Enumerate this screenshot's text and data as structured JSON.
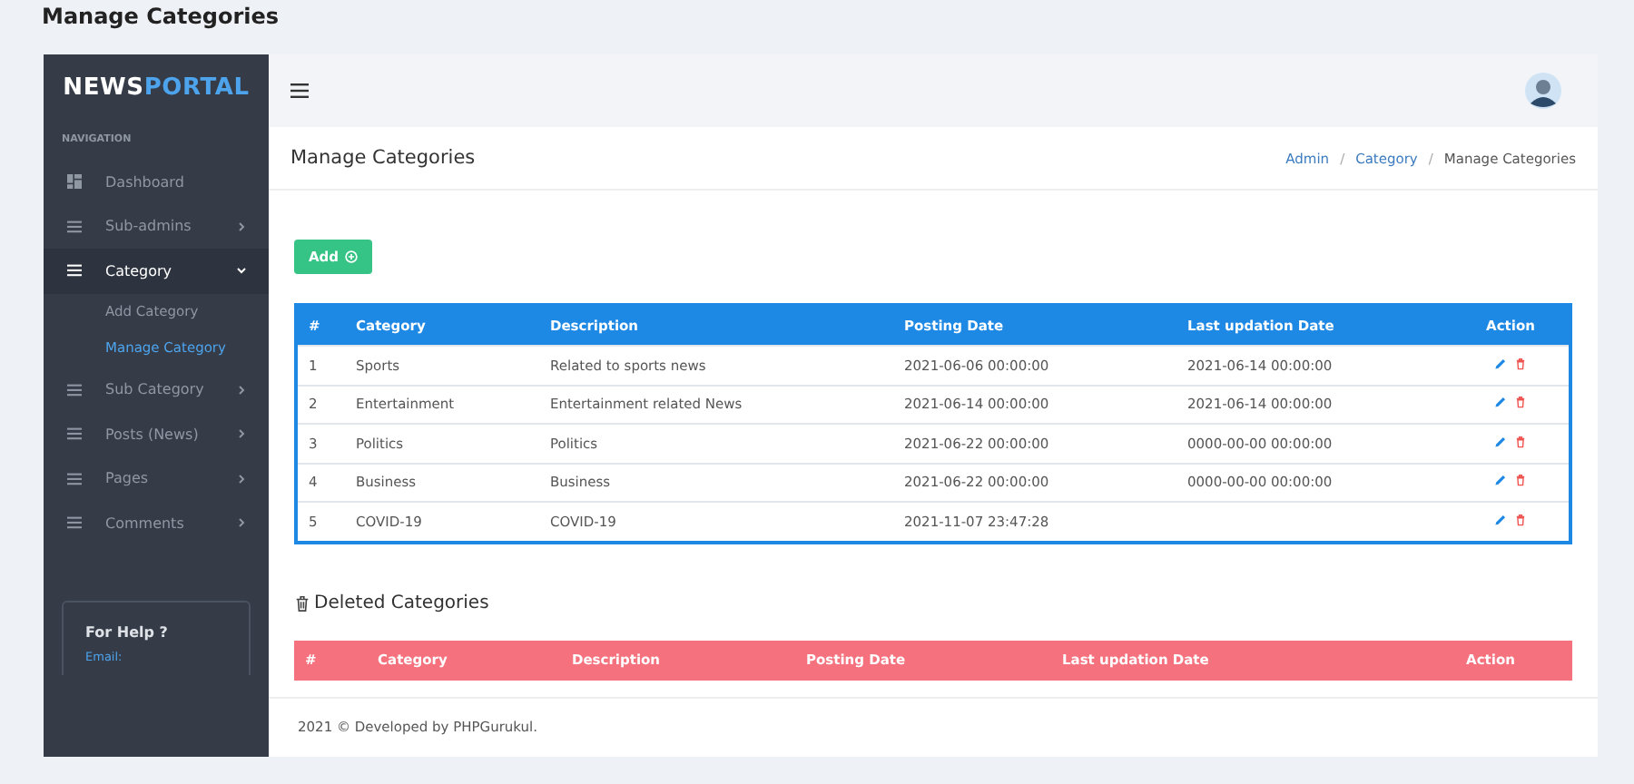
{
  "page_title": "Manage Categories",
  "sidebar": {
    "logo": {
      "primary": "NEWS",
      "accent": "PORTAL"
    },
    "section": "NAVIGATION",
    "items": [
      {
        "label": "Dashboard",
        "kind": "dashboard",
        "selected": false
      },
      {
        "label": "Sub-admins",
        "kind": "list",
        "selected": false,
        "expanded": false
      },
      {
        "label": "Category",
        "kind": "list",
        "selected": true,
        "expanded": true,
        "children": [
          {
            "label": "Add Category",
            "selected": false
          },
          {
            "label": "Manage Category",
            "selected": true
          }
        ]
      },
      {
        "label": "Sub Category",
        "kind": "list",
        "selected": false,
        "expanded": false
      },
      {
        "label": "Posts (News)",
        "kind": "list",
        "selected": false,
        "expanded": false
      },
      {
        "label": "Pages",
        "kind": "list",
        "selected": false,
        "expanded": false
      },
      {
        "label": "Comments",
        "kind": "list",
        "selected": false,
        "expanded": false
      }
    ],
    "help": {
      "title": "For Help ?",
      "label": "Email:"
    }
  },
  "header": {
    "title": "Manage Categories",
    "separator": "/",
    "breadcrumb": [
      {
        "label": "Admin",
        "link": true
      },
      {
        "label": "Category",
        "link": true
      },
      {
        "label": "Manage Categories",
        "link": false
      }
    ]
  },
  "add_button": "Add",
  "table": {
    "columns": [
      "#",
      "Category",
      "Description",
      "Posting Date",
      "Last updation Date",
      "Action"
    ],
    "rows": [
      [
        "1",
        "Sports",
        "Related to sports news",
        "2021-06-06 00:00:00",
        "2021-06-14 00:00:00"
      ],
      [
        "2",
        "Entertainment",
        "Entertainment related News",
        "2021-06-14 00:00:00",
        "2021-06-14 00:00:00"
      ],
      [
        "3",
        "Politics",
        "Politics",
        "2021-06-22 00:00:00",
        "0000-00-00 00:00:00"
      ],
      [
        "4",
        "Business",
        "Business",
        "2021-06-22 00:00:00",
        "0000-00-00 00:00:00"
      ],
      [
        "5",
        "COVID-19",
        "COVID-19",
        "2021-11-07 23:47:28",
        ""
      ]
    ]
  },
  "deleted": {
    "title": "Deleted Categories",
    "columns": [
      "#",
      "Category",
      "Description",
      "Posting Date",
      "Last updation Date",
      "Action"
    ]
  },
  "footer": "2021 © Developed by PHPGurukul."
}
